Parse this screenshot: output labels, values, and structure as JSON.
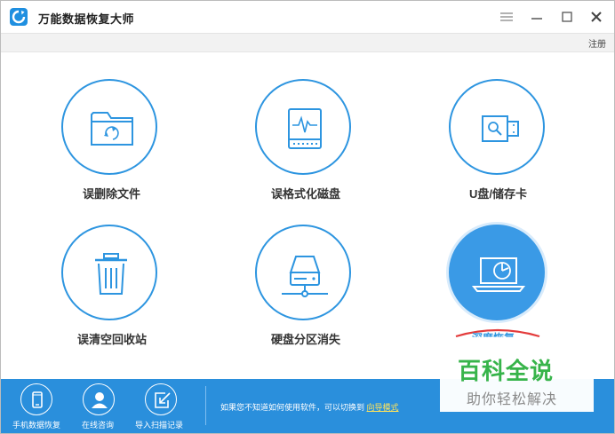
{
  "app": {
    "title": "万能数据恢复大师"
  },
  "menu": {
    "register_label": "注册"
  },
  "tiles": [
    {
      "label": "误删除文件"
    },
    {
      "label": "误格式化磁盘"
    },
    {
      "label": "U盘/储存卡"
    },
    {
      "label": "误清空回收站"
    },
    {
      "label": "硬盘分区消失"
    },
    {
      "label": "深度恢复"
    }
  ],
  "bottom": {
    "buttons": [
      {
        "label": "手机数据恢复",
        "icon": "phone-icon"
      },
      {
        "label": "在线咨询",
        "icon": "user-icon"
      },
      {
        "label": "导入扫描记录",
        "icon": "import-icon"
      }
    ],
    "hint_text": "如果您不知道如何使用软件，可以切换到",
    "hint_link": "向导模式"
  },
  "watermark": {
    "title": "百科全说",
    "subtitle": "助你轻松解决"
  },
  "colors": {
    "accent": "#2d95e0",
    "bottom_bar": "#2a8fdc",
    "active_tile": "#3a9ae6",
    "link": "#ffe35a",
    "watermark_green": "#37b44a"
  }
}
